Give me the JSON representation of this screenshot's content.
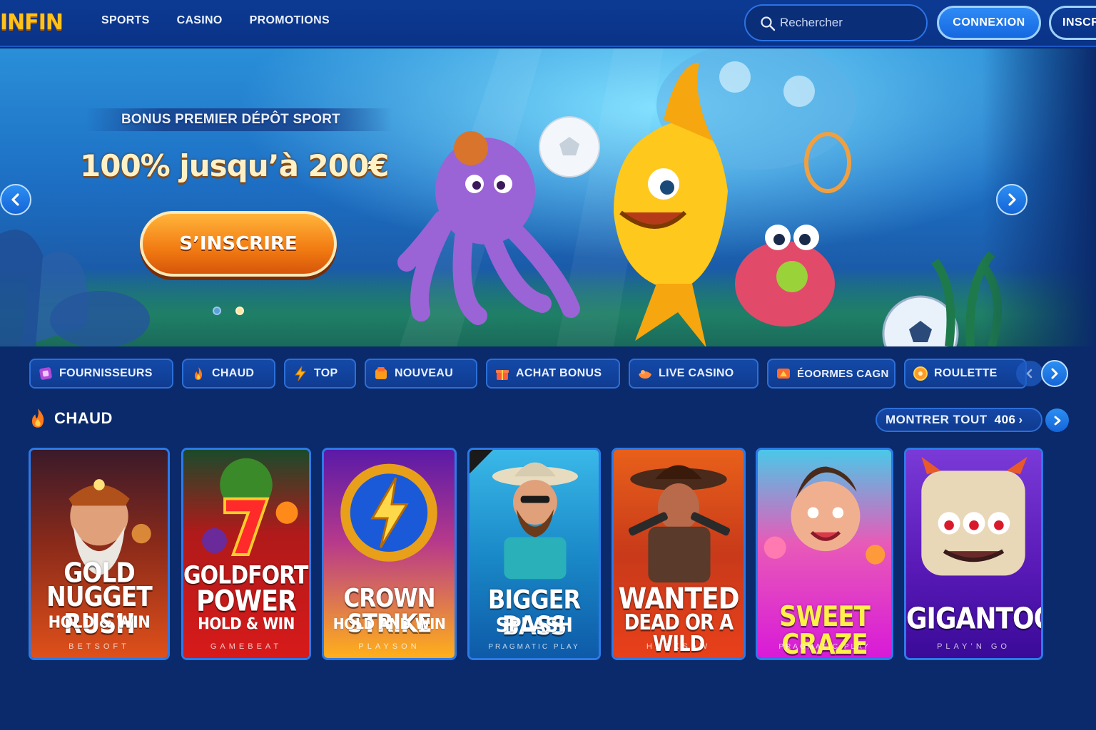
{
  "header": {
    "logo": "INFIN",
    "nav": [
      "SPORTS",
      "CASINO",
      "PROMOTIONS"
    ],
    "search_placeholder": "Rechercher",
    "login_label": "CONNEXION",
    "signup_label": "INSCRIPTION"
  },
  "banner": {
    "subtitle": "BONUS PREMIER DÉPÔT SPORT",
    "title": "100% jusqu’à 200€",
    "cta_label": "S’INSCRIRE",
    "slides_count": 2,
    "active_slide": 2
  },
  "categories": [
    {
      "label": "FOURNISSEURS",
      "icon": "providers-icon"
    },
    {
      "label": "CHAUD",
      "icon": "flame-icon"
    },
    {
      "label": "TOP",
      "icon": "lightning-icon"
    },
    {
      "label": "NOUVEAU",
      "icon": "new-tag-icon"
    },
    {
      "label": "ACHAT BONUS",
      "icon": "gift-icon"
    },
    {
      "label": "LIVE CASINO",
      "icon": "live-dealer-icon"
    },
    {
      "label": "ÉOORMES CAGN",
      "icon": "jackpot-icon"
    },
    {
      "label": "ROULETTE",
      "icon": "roulette-icon"
    }
  ],
  "section": {
    "title": "CHAUD",
    "show_all_label": "MONTRER TOUT",
    "count": "406",
    "chevron": "›"
  },
  "games": [
    {
      "name1": "GOLD",
      "name2": "NUGGET RUSH",
      "sub": "HOLD & WIN",
      "provider": "BETSOFT"
    },
    {
      "name1": "GOLDFORTUNE",
      "name2": "POWER",
      "sub": "HOLD & WIN",
      "provider": "GAMEBEAT"
    },
    {
      "name1": "CROWN STRIKE",
      "name2": "",
      "sub": "HOLD AND WIN",
      "provider": "PLAYSON"
    },
    {
      "name1": "BIGGER BASS",
      "name2": "",
      "sub": "SPLASH",
      "provider": "PRAGMATIC PLAY"
    },
    {
      "name1": "WANTED",
      "name2": "DEAD OR A WILD",
      "sub": "",
      "provider": "HACKSAW"
    },
    {
      "name1": "SWEET CRAZE",
      "name2": "",
      "sub": "",
      "provider": "PRAGMATIC PLAY"
    },
    {
      "name1": "GIGANTOOZ",
      "name2": "",
      "sub": "",
      "provider": "PLAY’N GO"
    }
  ],
  "colors": {
    "background": "#0a2a6b",
    "accent": "#2b8ff2",
    "logo": "#ffc21a",
    "cta": "#f27a12"
  }
}
